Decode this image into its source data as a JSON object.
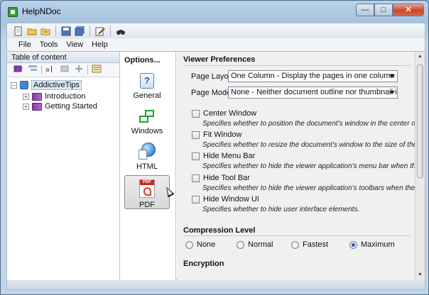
{
  "window": {
    "title": "HelpNDoc",
    "caption_buttons": {
      "minimize": "—",
      "maximize": "□",
      "close": "✕"
    }
  },
  "toolbar": {
    "icons": [
      "new-file-icon",
      "open-folder-icon",
      "open-recent-icon",
      "save-icon",
      "save-all-icon",
      "edit-icon",
      "find-icon"
    ]
  },
  "menu": {
    "items": [
      "File",
      "Tools",
      "View",
      "Help"
    ]
  },
  "toc": {
    "header": "Table of content",
    "tree": {
      "root": "AddictiveTips",
      "children": [
        "Introduction",
        "Getting Started"
      ]
    }
  },
  "options": {
    "title": "Options...",
    "items": [
      {
        "label": "General",
        "selected": false
      },
      {
        "label": "Windows",
        "selected": false
      },
      {
        "label": "HTML",
        "selected": false
      },
      {
        "label": "PDF",
        "selected": true
      }
    ]
  },
  "settings": {
    "viewer_title": "Viewer Preferences",
    "page_layout": {
      "label": "Page Layout:",
      "value": "One Column - Display the pages in one column"
    },
    "page_mode": {
      "label": "Page Mode:",
      "value": "None - Neither document outline nor thumbnail images visible"
    },
    "checkboxes": [
      {
        "label": "Center Window",
        "desc": "Specifies whether to position the document's window in the center of the screen",
        "checked": false
      },
      {
        "label": "Fit Window",
        "desc": "Specifies whether to resize the document's window to the size of the first displayed page",
        "checked": false
      },
      {
        "label": "Hide Menu Bar",
        "desc": "Specifies whether to hide the viewer application's menu bar when the document is active",
        "checked": false
      },
      {
        "label": "Hide Tool Bar",
        "desc": "Specifies whether to hide the viewer application's toolbars when the document is active",
        "checked": false
      },
      {
        "label": "Hide Window UI",
        "desc": "Specifies whether to hide user interface elements.",
        "checked": false
      }
    ],
    "compression_title": "Compression Level",
    "compression_options": [
      {
        "label": "None",
        "selected": false
      },
      {
        "label": "Normal",
        "selected": false
      },
      {
        "label": "Fastest",
        "selected": false
      },
      {
        "label": "Maximum",
        "selected": true
      }
    ],
    "encryption_title": "Encryption"
  },
  "colors": {
    "selected_radio": "#1f5fb0",
    "window_frame": "#a7c3de"
  }
}
